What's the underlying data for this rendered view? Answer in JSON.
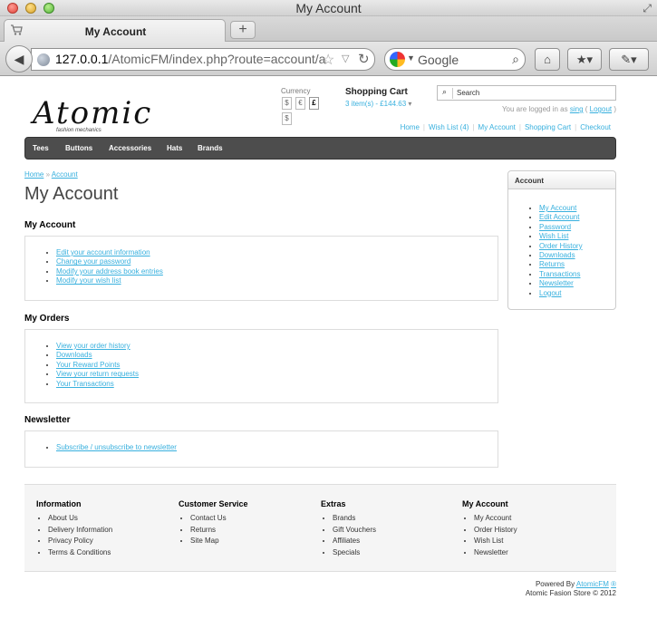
{
  "window": {
    "title": "My Account"
  },
  "tab": {
    "title": "My Account",
    "new_tab_label": "+"
  },
  "toolbar": {
    "url_host": "127.0.0.1",
    "url_path": "/AtomicFM/index.php?route=account/a",
    "search_engine": "Google"
  },
  "header": {
    "logo_text": "Atomic",
    "logo_tagline": "fashion mechanics",
    "currency_label": "Currency",
    "currencies": [
      "$",
      "€",
      "£",
      "$"
    ],
    "cart_title": "Shopping Cart",
    "cart_summary": "3 item(s) - £144.63",
    "search_placeholder": "Search",
    "welcome_prefix": "You are logged in as",
    "username": "sing",
    "logout": "Logout",
    "top_links": [
      "Home",
      "Wish List (4)",
      "My Account",
      "Shopping Cart",
      "Checkout"
    ]
  },
  "menu": [
    "Tees",
    "Buttons",
    "Accessories",
    "Hats",
    "Brands"
  ],
  "breadcrumb": [
    "Home",
    "Account"
  ],
  "page_title": "My Account",
  "sections": [
    {
      "heading": "My Account",
      "links": [
        "Edit your account information",
        "Change your password",
        "Modify your address book entries",
        "Modify your wish list"
      ]
    },
    {
      "heading": "My Orders",
      "links": [
        "View your order history",
        "Downloads",
        "Your Reward Points",
        "View your return requests",
        "Your Transactions"
      ]
    },
    {
      "heading": "Newsletter",
      "links": [
        "Subscribe / unsubscribe to newsletter"
      ]
    }
  ],
  "sidebar": {
    "heading": "Account",
    "links": [
      "My Account",
      "Edit Account",
      "Password",
      "Wish List",
      "Order History",
      "Downloads",
      "Returns",
      "Transactions",
      "Newsletter",
      "Logout"
    ]
  },
  "footer": {
    "columns": [
      {
        "heading": "Information",
        "links": [
          "About Us",
          "Delivery Information",
          "Privacy Policy",
          "Terms & Conditions"
        ]
      },
      {
        "heading": "Customer Service",
        "links": [
          "Contact Us",
          "Returns",
          "Site Map"
        ]
      },
      {
        "heading": "Extras",
        "links": [
          "Brands",
          "Gift Vouchers",
          "Affiliates",
          "Specials"
        ]
      },
      {
        "heading": "My Account",
        "links": [
          "My Account",
          "Order History",
          "Wish List",
          "Newsletter"
        ]
      }
    ],
    "powered_prefix": "Powered By",
    "powered_brand": "AtomicFM",
    "copyright": "Atomic Fasion Store © 2012"
  },
  "colors": {
    "link": "#38b0de",
    "menu_bg": "#4d4d4d"
  }
}
